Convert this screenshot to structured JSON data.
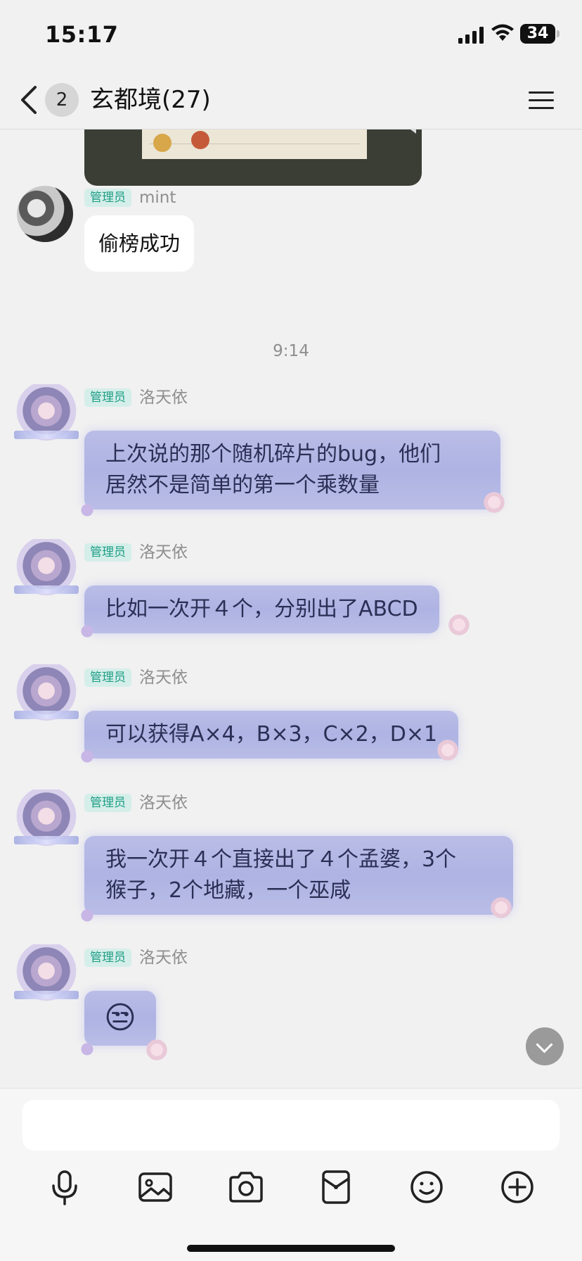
{
  "status_bar": {
    "time": "15:17",
    "battery": "34"
  },
  "header": {
    "unread_count": "2",
    "title": "玄都境(27)"
  },
  "messages": [
    {
      "role_tag": "管理员",
      "sender": "mint",
      "text": "偷榜成功",
      "bubble": "white"
    },
    {
      "timestamp": "9:14"
    },
    {
      "role_tag": "管理员",
      "sender": "洛天依",
      "lines": [
        "上次说的那个随机碎片的bug，他们",
        "居然不是简单的第一个乘数量"
      ]
    },
    {
      "role_tag": "管理员",
      "sender": "洛天依",
      "text": "比如一次开４个，分别出了ABCD"
    },
    {
      "role_tag": "管理员",
      "sender": "洛天依",
      "text": "可以获得A×4，B×3，C×2，D×1"
    },
    {
      "role_tag": "管理员",
      "sender": "洛天依",
      "lines": [
        "我一次开４个直接出了４个孟婆，3个",
        "猴子，2个地藏，一个巫咸"
      ]
    },
    {
      "role_tag": "管理员",
      "sender": "洛天依",
      "text": "😒"
    }
  ],
  "toolbar": {
    "icons": [
      "microphone-icon",
      "image-icon",
      "camera-icon",
      "red-packet-icon",
      "emoji-icon",
      "plus-icon"
    ]
  },
  "colors": {
    "admin_tag_bg": "#d5eee9",
    "admin_tag_text": "#1e9e86",
    "bubble_purple": "#b3b7e4"
  }
}
